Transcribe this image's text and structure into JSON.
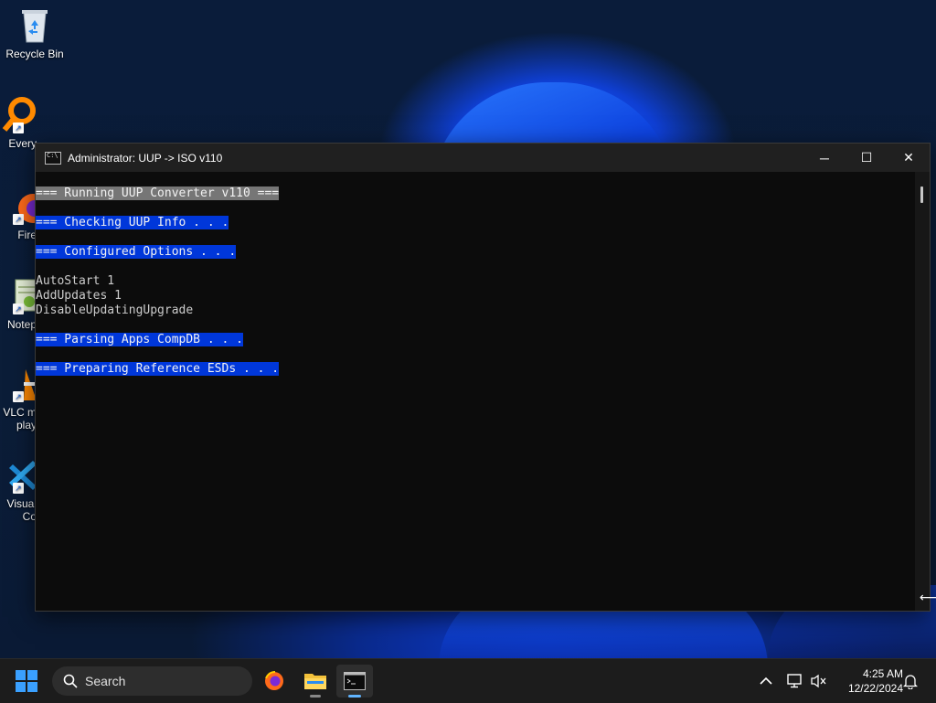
{
  "desktop": {
    "icons": [
      {
        "label": "Recycle Bin",
        "icon": "recycle-bin-icon"
      },
      {
        "label": "Every",
        "icon": "everything-search-icon"
      },
      {
        "label": "Fire",
        "icon": "firefox-icon"
      },
      {
        "label": "Notep",
        "icon": "notepad-plus-plus-icon"
      },
      {
        "label": "VLC m\nplay",
        "icon": "vlc-icon"
      },
      {
        "label": "Visual\nCo",
        "icon": "vscode-icon"
      }
    ]
  },
  "window": {
    "title": "Administrator:  UUP -> ISO v110",
    "controls": {
      "minimize": "─",
      "maximize": "☐",
      "close": "✕"
    }
  },
  "console": {
    "lines": [
      {
        "text": "=== Running UUP Converter v110 ===",
        "style": "gray"
      },
      {
        "text": "",
        "style": "none"
      },
      {
        "text": "=== Checking UUP Info . . .",
        "style": "blue"
      },
      {
        "text": "",
        "style": "none"
      },
      {
        "text": "=== Configured Options . . .",
        "style": "blue"
      },
      {
        "text": "",
        "style": "none"
      },
      {
        "text": "AutoStart 1",
        "style": "none"
      },
      {
        "text": "AddUpdates 1",
        "style": "none"
      },
      {
        "text": "DisableUpdatingUpgrade",
        "style": "none"
      },
      {
        "text": "",
        "style": "none"
      },
      {
        "text": "=== Parsing Apps CompDB . . .",
        "style": "blue"
      },
      {
        "text": "",
        "style": "none"
      },
      {
        "text": "=== Preparing Reference ESDs . . .",
        "style": "blue"
      }
    ]
  },
  "taskbar": {
    "search_placeholder": "Search",
    "apps": [
      {
        "name": "firefox-taskbar-button",
        "icon": "firefox-icon"
      },
      {
        "name": "file-explorer-taskbar-button",
        "icon": "folder-icon"
      },
      {
        "name": "cmd-taskbar-button",
        "icon": "terminal-icon",
        "active": true
      }
    ],
    "time": "4:25 AM",
    "date": "12/22/2024"
  },
  "colors": {
    "highlight_gray": "#767676",
    "highlight_blue": "#0037da",
    "console_bg": "#0c0c0c",
    "taskbar_bg": "#1c1c1c",
    "accent": "#60b4ff"
  }
}
